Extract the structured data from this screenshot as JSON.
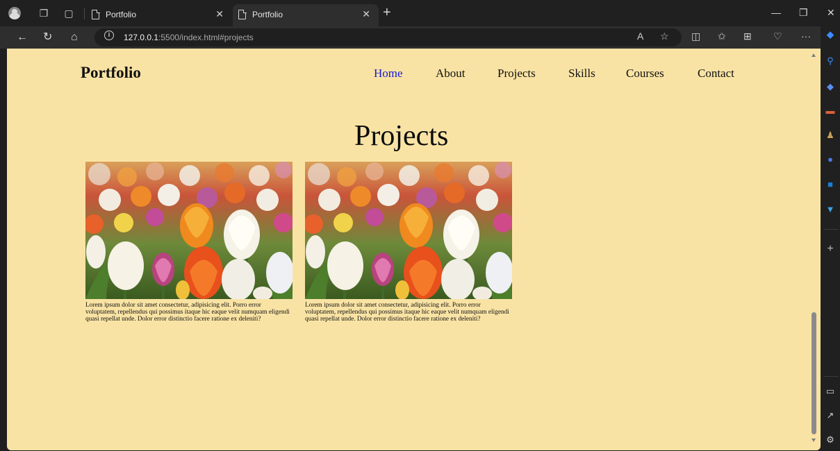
{
  "browser": {
    "tabs": [
      {
        "title": "Portfolio",
        "active": false
      },
      {
        "title": "Portfolio",
        "active": true
      }
    ],
    "url": {
      "host": "127.0.0.1",
      "rest": ":5500/index.html#projects"
    }
  },
  "site": {
    "logo": "Portfolio",
    "nav": [
      {
        "label": "Home",
        "active": true
      },
      {
        "label": "About"
      },
      {
        "label": "Projects"
      },
      {
        "label": "Skills"
      },
      {
        "label": "Courses"
      },
      {
        "label": "Contact"
      }
    ],
    "section_title": "Projects",
    "projects": [
      {
        "description": "Lorem ipsum dolor sit amet consectetur, adipisicing elit. Porro error voluptatem, repellendus qui possimus itaque hic eaque velit numquam eligendi quasi repellat unde. Dolor error distinctio facere ratione ex deleniti?"
      },
      {
        "description": "Lorem ipsum dolor sit amet consectetur, adipisicing elit. Porro error voluptatem, repellendus qui possimus itaque hic eaque velit numquam eligendi quasi repellat unde. Dolor error distinctio facere ratione ex deleniti?"
      }
    ]
  },
  "colors": {
    "page_bg": "#f9e3a4",
    "nav_active": "#1a1ad6",
    "chrome_dark": "#202020"
  }
}
